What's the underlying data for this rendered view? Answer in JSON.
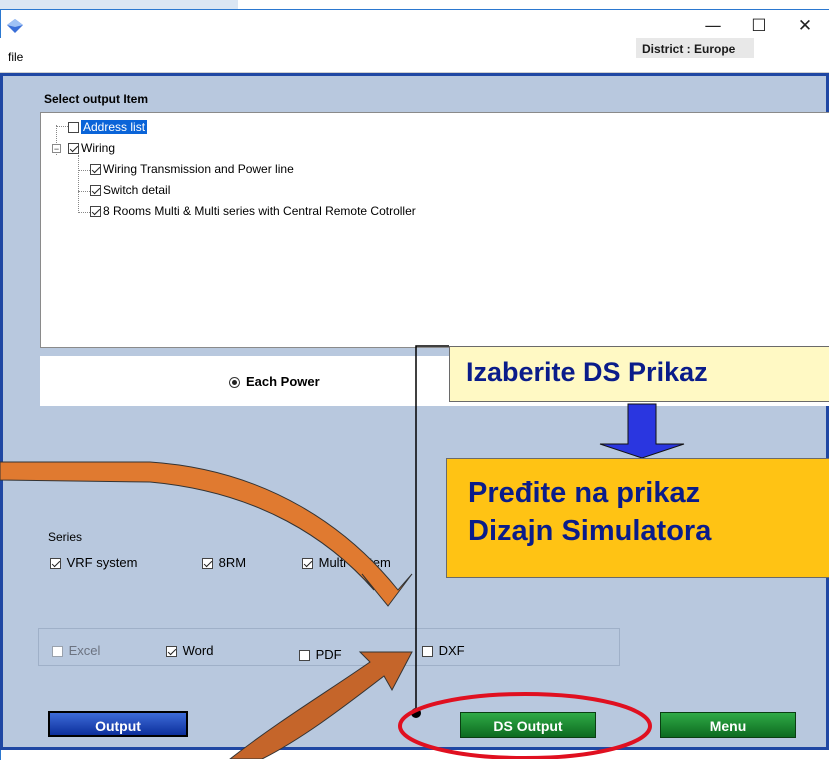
{
  "window": {
    "minimize_glyph": "—",
    "maximize_glyph": "☐",
    "close_glyph": "✕"
  },
  "menubar": {
    "file_label": "file",
    "district_label": "District : Europe"
  },
  "output_items": {
    "title": "Select output Item",
    "nodes": [
      {
        "label": "Address list",
        "checked": false,
        "selected": true
      },
      {
        "label": "Wiring",
        "checked": true
      },
      {
        "label": "Wiring Transmission and Power line",
        "checked": true
      },
      {
        "label": "Switch detail",
        "checked": true
      },
      {
        "label": "8 Rooms Multi & Multi series with Central Remote Cotroller",
        "checked": true
      }
    ]
  },
  "power": {
    "option_label": "Each Power"
  },
  "series": {
    "label": "Series",
    "options": [
      {
        "label": "VRF system",
        "checked": true
      },
      {
        "label": "8RM",
        "checked": true
      },
      {
        "label": "Multi system",
        "checked": true
      }
    ]
  },
  "formats": [
    {
      "label": "Excel",
      "checked": false,
      "enabled": false
    },
    {
      "label": "Word",
      "checked": true,
      "enabled": true
    },
    {
      "label": "PDF",
      "checked": false,
      "enabled": true
    },
    {
      "label": "DXF",
      "checked": false,
      "enabled": true
    }
  ],
  "buttons": {
    "output": "Output",
    "ds_output": "DS Output",
    "menu": "Menu"
  },
  "annotations": {
    "callout_top": "Izaberite DS Prikaz",
    "callout_bottom_line1": "Pređite na prikaz",
    "callout_bottom_line2": "Dizajn Simulatora"
  },
  "colors": {
    "panel_background": "#b8c8de",
    "frame_border": "#1f47a3",
    "output_button": "#0c2f9c",
    "green_buttons": "#1a8a32",
    "callout_yellow": "#fff9c4",
    "callout_orange": "#ffc314",
    "callout_text": "#0a1c8a",
    "highlight_ellipse": "#e01020",
    "arrow_orange": "#e07a30",
    "arrow_blue": "#2a36e0"
  }
}
